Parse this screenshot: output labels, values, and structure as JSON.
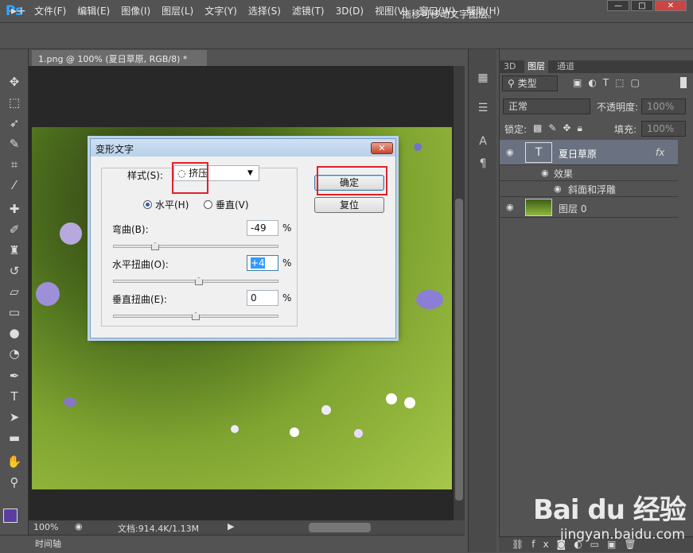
{
  "app": {
    "logo": "Ps"
  },
  "menubar": {
    "items": [
      "文件(F)",
      "编辑(E)",
      "图像(I)",
      "图层(L)",
      "文字(Y)",
      "选择(S)",
      "滤镜(T)",
      "3D(D)",
      "视图(V)",
      "窗口(W)",
      "帮助(H)"
    ]
  },
  "window_controls": {
    "minimize": "—",
    "maximize": "□",
    "close": "✕"
  },
  "options_bar": {
    "tool_icon": "move-tool-icon",
    "tool_glyph": "▸+",
    "hint": "拖移可移动文字图层。"
  },
  "document": {
    "tab_title": "1.png @ 100% (夏日草原, RGB/8) *",
    "tab_close": "×",
    "zoom": "100%",
    "doc_info": "文档:914.4K/1.13M"
  },
  "timeline": {
    "label": "时间轴"
  },
  "panel": {
    "tabs": [
      "3D",
      "图层",
      "通道"
    ],
    "filter_kind": "类型",
    "blend_mode": "正常",
    "opacity_label": "不透明度:",
    "opacity_value": "100%",
    "lock_label": "锁定:",
    "fill_label": "填充:",
    "fill_value": "100%",
    "layers": [
      {
        "name": "夏日草原",
        "thumb": "T",
        "fx": "fx"
      },
      {
        "name": "效果"
      },
      {
        "name": "斜面和浮雕"
      },
      {
        "name": "图层 0"
      }
    ]
  },
  "dialog": {
    "title": "变形文字",
    "close": "✕",
    "style_label": "样式(S):",
    "style_value": "挤压",
    "horizontal_label": "水平(H)",
    "vertical_label": "垂直(V)",
    "orientation_selected": "horizontal",
    "bend_label": "弯曲(B):",
    "bend_value": "-49",
    "hdistort_label": "水平扭曲(O):",
    "hdistort_value": "+4",
    "vdistort_label": "垂直扭曲(E):",
    "vdistort_value": "0",
    "percent": "%",
    "ok_label": "确定",
    "reset_label": "复位"
  },
  "watermark": {
    "brand": "Bai du 经验",
    "url": "jingyan.baidu.com"
  },
  "colors": {
    "ps_blue": "#31a8ff",
    "foreground": "#5b3fa0",
    "background": "#ffffff",
    "highlight_red": "#e2202a"
  }
}
